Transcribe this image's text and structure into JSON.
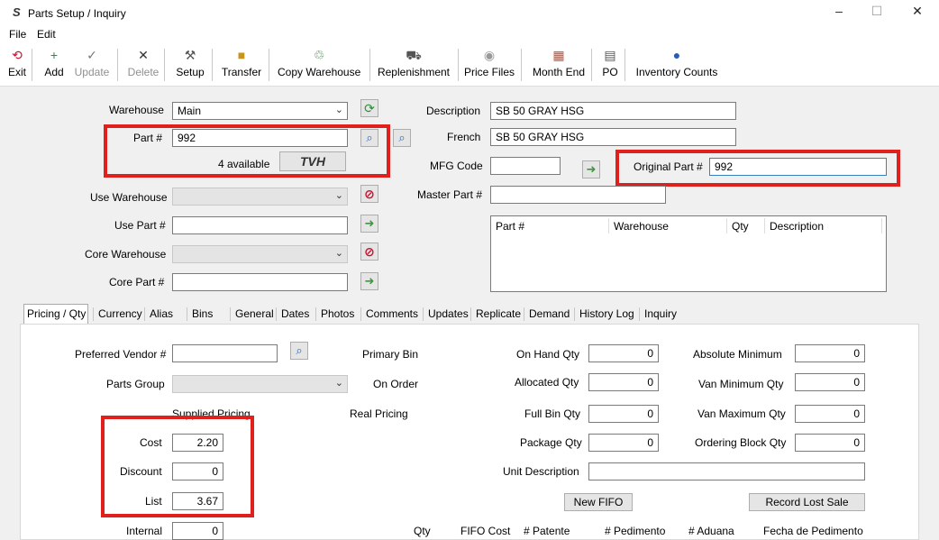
{
  "window": {
    "title": "Parts Setup / Inquiry",
    "app_icon": "S",
    "min": "–",
    "max": "☐",
    "close": "✕"
  },
  "menu": [
    "File",
    "Edit"
  ],
  "toolbar": [
    {
      "label": "Exit",
      "icon": "exit-icon",
      "glyph": "⟲",
      "color": "#c8102e",
      "enabled": true
    },
    {
      "label": "Add",
      "icon": "add-icon",
      "glyph": "+",
      "color": "#2c8c3c",
      "enabled": true
    },
    {
      "label": "Update",
      "icon": "check-icon",
      "glyph": "✓",
      "color": "#777777",
      "enabled": false
    },
    {
      "label": "Delete",
      "icon": "delete-icon",
      "glyph": "✕",
      "color": "#333333",
      "enabled": false
    },
    {
      "label": "Setup",
      "icon": "tools-icon",
      "glyph": "⚒",
      "color": "#555555",
      "enabled": true
    },
    {
      "label": "Transfer",
      "icon": "transfer-box-icon",
      "glyph": "■",
      "color": "#c8941c",
      "enabled": true
    },
    {
      "label": "Copy Warehouse",
      "icon": "copy-warehouse-icon",
      "glyph": "♲",
      "color": "#3a7a3a",
      "enabled": true
    },
    {
      "label": "Replenishment",
      "icon": "truck-icon",
      "glyph": "⛟",
      "color": "#555555",
      "enabled": true
    },
    {
      "label": "Price Files",
      "icon": "disc-icon",
      "glyph": "◉",
      "color": "#999999",
      "enabled": true
    },
    {
      "label": "Month End",
      "icon": "calendar-icon",
      "glyph": "▦",
      "color": "#c84a2c",
      "enabled": true
    },
    {
      "label": "PO",
      "icon": "po-icon",
      "glyph": "▤",
      "color": "#555555",
      "enabled": true
    },
    {
      "label": "Inventory Counts",
      "icon": "inventory-counts-icon",
      "glyph": "●",
      "color": "#2a5bb8",
      "enabled": true
    }
  ],
  "form": {
    "warehouse_label": "Warehouse",
    "warehouse_value": "Main",
    "part_label": "Part #",
    "part_value": "992",
    "available_text": "4 available",
    "tvh_logo": "TVH",
    "use_warehouse_label": "Use Warehouse",
    "use_part_label": "Use Part #",
    "core_warehouse_label": "Core Warehouse",
    "core_part_label": "Core Part #",
    "description_label": "Description",
    "description_value": "SB 50 GRAY HSG",
    "french_label": "French",
    "french_value": "SB 50 GRAY HSG",
    "mfg_code_label": "MFG Code",
    "mfg_code_value": "",
    "original_part_label": "Original Part #",
    "original_part_value": "992",
    "master_part_label": "Master Part #",
    "master_part_value": ""
  },
  "grid": {
    "columns": [
      "Part #",
      "Warehouse",
      "Qty",
      "Description"
    ]
  },
  "tabs": [
    "Pricing / Qty",
    "Currency",
    "Alias",
    "Bins",
    "General",
    "Dates",
    "Photos",
    "Comments",
    "Updates",
    "Replicate",
    "Demand",
    "History Log",
    "Inquiry"
  ],
  "active_tab": "Pricing / Qty",
  "pricing": {
    "preferred_vendor_label": "Preferred Vendor #",
    "parts_group_label": "Parts Group",
    "supplied_pricing_label": "Supplied Pricing",
    "cost_label": "Cost",
    "cost_value": "2.20",
    "discount_label": "Discount",
    "discount_value": "0",
    "list_label": "List",
    "list_value": "3.67",
    "internal_label": "Internal",
    "internal_value": "0",
    "primary_bin_label": "Primary Bin",
    "on_order_label": "On Order",
    "real_pricing_label": "Real Pricing",
    "on_hand_label": "On Hand Qty",
    "on_hand_value": "0",
    "allocated_label": "Allocated Qty",
    "allocated_value": "0",
    "full_bin_label": "Full Bin Qty",
    "full_bin_value": "0",
    "package_label": "Package Qty",
    "package_value": "0",
    "unit_description_label": "Unit Description",
    "abs_min_label": "Absolute Minimum",
    "abs_min_value": "0",
    "van_min_label": "Van Minimum Qty",
    "van_min_value": "0",
    "van_max_label": "Van Maximum Qty",
    "van_max_value": "0",
    "ordering_block_label": "Ordering Block Qty",
    "ordering_block_value": "0",
    "new_fifo_label": "New FIFO",
    "record_lost_sale_label": "Record Lost Sale",
    "fifo_columns": [
      "Qty",
      "FIFO Cost",
      "# Patente",
      "# Pedimento",
      "# Aduana",
      "Fecha de Pedimento"
    ]
  },
  "colors": {
    "highlight": "#e0201c"
  }
}
